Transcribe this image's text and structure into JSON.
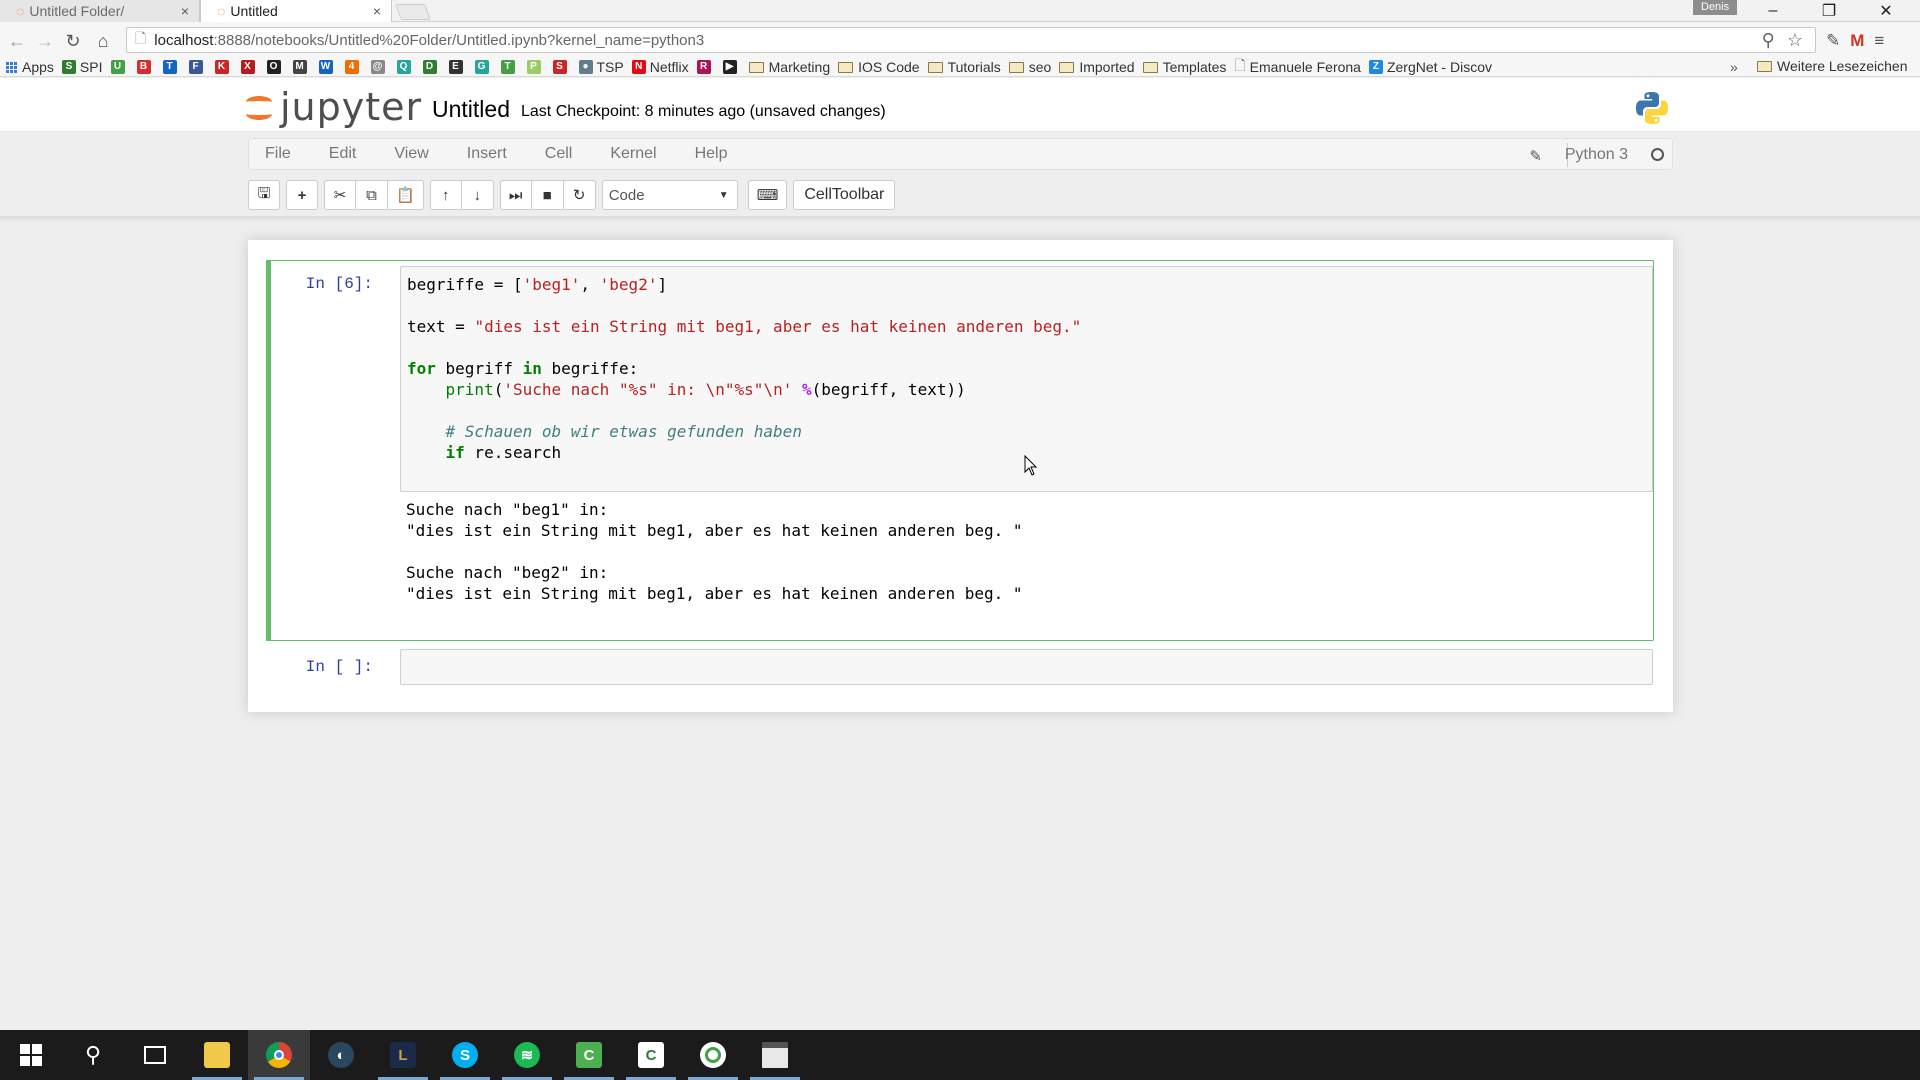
{
  "browser": {
    "tabs": [
      {
        "label": "Untitled Folder/",
        "active": false
      },
      {
        "label": "Untitled",
        "active": true
      }
    ],
    "profile": "Denis",
    "url_host": "localhost",
    "url_path": ":8888/notebooks/Untitled%20Folder/Untitled.ipynb?kernel_name=python3",
    "bookmarks": [
      {
        "label": "Apps",
        "icon": "apps-grid"
      },
      {
        "label": "SPI",
        "icon": "spi",
        "color": "#2e7d32"
      },
      {
        "label": "",
        "icon": "u",
        "color": "#43a047"
      },
      {
        "label": "",
        "icon": "b",
        "color": "#d32f2f"
      },
      {
        "label": "",
        "icon": "t",
        "color": "#1565c0"
      },
      {
        "label": "",
        "icon": "f",
        "color": "#3b5998"
      },
      {
        "label": "",
        "icon": "k",
        "color": "#c62828"
      },
      {
        "label": "",
        "icon": "x",
        "color": "#b71c1c"
      },
      {
        "label": "",
        "icon": "o",
        "color": "#222222"
      },
      {
        "label": "",
        "icon": "m",
        "color": "#444444"
      },
      {
        "label": "",
        "icon": "w",
        "color": "#1565c0"
      },
      {
        "label": "",
        "icon": "4",
        "color": "#ef6c00"
      },
      {
        "label": "",
        "icon": "@",
        "color": "#888888"
      },
      {
        "label": "",
        "icon": "q",
        "color": "#26a69a"
      },
      {
        "label": "",
        "icon": "d",
        "color": "#2e7d32"
      },
      {
        "label": "",
        "icon": "e",
        "color": "#333333"
      },
      {
        "label": "",
        "icon": "g",
        "color": "#26a69a"
      },
      {
        "label": "",
        "icon": "tc",
        "color": "#43a047"
      },
      {
        "label": "",
        "icon": "p",
        "color": "#9ccc65"
      },
      {
        "label": "",
        "icon": "sn",
        "color": "#c62828"
      },
      {
        "label": "TSP",
        "icon": "globe",
        "color": "#607d8b"
      },
      {
        "label": "Netflix",
        "icon": "n",
        "color": "#e50914"
      },
      {
        "label": "",
        "icon": "r",
        "color": "#ad1457"
      },
      {
        "label": "",
        "icon": "play",
        "color": "#222222"
      },
      {
        "label": "Marketing",
        "icon": "folder"
      },
      {
        "label": "IOS Code",
        "icon": "folder"
      },
      {
        "label": "Tutorials",
        "icon": "folder"
      },
      {
        "label": "seo",
        "icon": "folder"
      },
      {
        "label": "Imported",
        "icon": "folder"
      },
      {
        "label": "Templates",
        "icon": "folder"
      },
      {
        "label": "Emanuele Ferona",
        "icon": "page"
      },
      {
        "label": "ZergNet - Discov",
        "icon": "z",
        "color": "#1e88e5"
      }
    ],
    "bookmarks_more": "»",
    "other_bookmarks": "Weitere Lesezeichen"
  },
  "jupyter": {
    "logo_text": "jupyter",
    "notebook_title": "Untitled",
    "checkpoint": "Last Checkpoint: 8 minutes ago (unsaved changes)",
    "menu": [
      "File",
      "Edit",
      "View",
      "Insert",
      "Cell",
      "Kernel",
      "Help"
    ],
    "kernel_name": "Python 3",
    "cell_type": "Code",
    "celltoolbar_label": "CellToolbar"
  },
  "cells": [
    {
      "prompt": "In [6]:",
      "output": "Suche nach \"beg1\" in:\n\"dies ist ein String mit beg1, aber es hat keinen anderen beg. \"\n\nSuche nach \"beg2\" in:\n\"dies ist ein String mit beg1, aber es hat keinen anderen beg. \""
    },
    {
      "prompt": "In [ ]:"
    }
  ],
  "code_tokens": {
    "l1": [
      "begriffe = [",
      "'beg1'",
      ", ",
      "'beg2'",
      "]"
    ],
    "l3": [
      "text = ",
      "\"dies ist ein String mit beg1, aber es hat keinen anderen beg.\""
    ],
    "l5": [
      "for",
      " begriff ",
      "in",
      " begriffe:"
    ],
    "l6": [
      "    ",
      "print",
      "(",
      "'Suche nach \"%s\" in: \\n\"%s\"\\n'",
      " ",
      "%",
      "(begriff, text))"
    ],
    "l8": [
      "    ",
      "# Schauen ob wir etwas gefunden haben"
    ],
    "l9": [
      "    ",
      "if",
      " re.search"
    ]
  },
  "colors": {
    "selected_cell_border": "#66bb6a",
    "prompt_color": "#303f9f",
    "jupyter_orange": "#f37726"
  }
}
